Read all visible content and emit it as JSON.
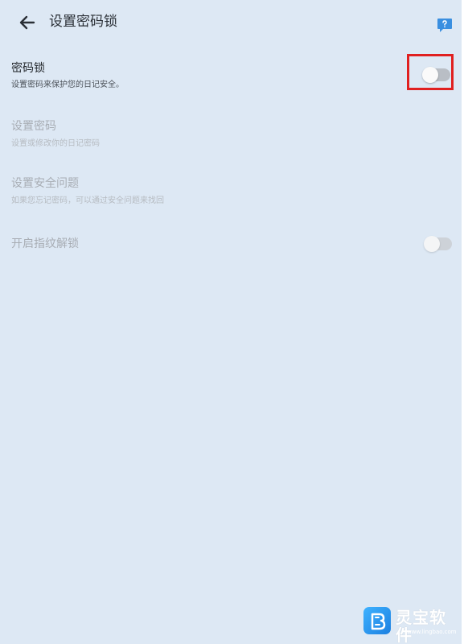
{
  "header": {
    "title": "设置密码锁",
    "back_icon": "arrow-left-icon",
    "feedback_icon": "chat-bubble-icon"
  },
  "settings": [
    {
      "title": "密码锁",
      "subtitle": "设置密码来保护您的日记安全。",
      "toggle": "off",
      "enabled": true
    },
    {
      "title": "设置密码",
      "subtitle": "设置或修改你的日记密码",
      "enabled": false
    },
    {
      "title": "设置安全问题",
      "subtitle": "如果您忘记密码，可以通过安全问题来找回",
      "enabled": false
    },
    {
      "title": "开启指纹解锁",
      "toggle": "off",
      "enabled": false
    }
  ],
  "watermark": {
    "name": "灵宝软件",
    "url": "www.lingbao.com"
  },
  "colors": {
    "background": "#dde8f4",
    "accent": "#3a8fe0",
    "highlight": "#e02020"
  }
}
